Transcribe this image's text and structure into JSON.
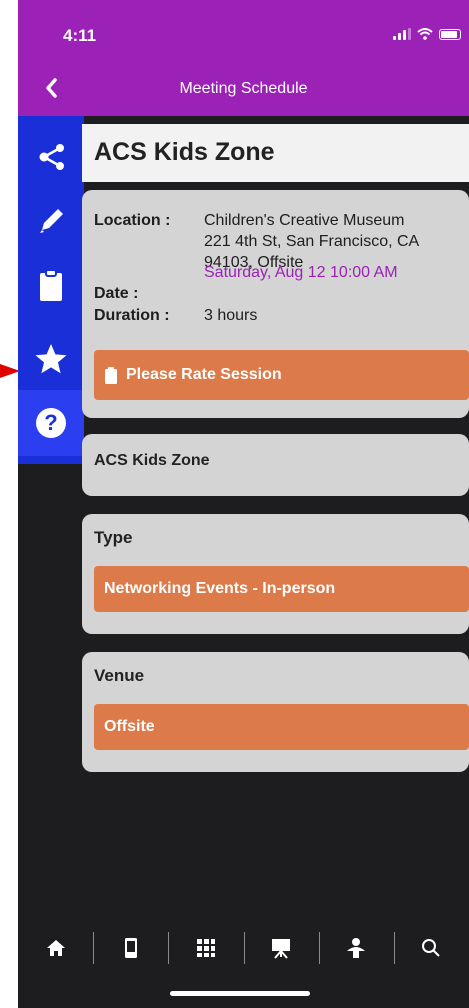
{
  "status_bar": {
    "time": "4:11"
  },
  "nav": {
    "title": "Meeting Schedule",
    "back_icon": "chevron-left-icon"
  },
  "side_toolbar": {
    "items": [
      {
        "icon": "share-icon"
      },
      {
        "icon": "pencil-icon"
      },
      {
        "icon": "clipboard-icon"
      },
      {
        "icon": "star-icon"
      },
      {
        "icon": "help-icon",
        "glyph": "?"
      }
    ]
  },
  "session": {
    "title": "ACS Kids Zone",
    "location_label": "Location :",
    "location_lines": [
      "Children's Creative Museum",
      "221 4th St, San Francisco, CA",
      "94103, Offsite"
    ],
    "date_label": "Date :",
    "date_value": "Saturday, Aug 12 10:00 AM",
    "duration_label": "Duration :",
    "duration_value": "3 hours",
    "rate_button": "Please Rate Session",
    "description": "ACS Kids Zone"
  },
  "type_section": {
    "label": "Type",
    "value": "Networking Events - In-person"
  },
  "venue_section": {
    "label": "Venue",
    "value": "Offsite"
  },
  "tab_bar": {
    "tabs": [
      {
        "icon": "home-icon"
      },
      {
        "icon": "phone-icon"
      },
      {
        "icon": "grid-icon"
      },
      {
        "icon": "presentation-icon"
      },
      {
        "icon": "person-icon"
      },
      {
        "icon": "search-icon"
      }
    ]
  },
  "colors": {
    "header": "#9c21b6",
    "toolbar": "#1a2fd8",
    "accent_button": "#dd7a4a",
    "card": "#d4d4d4",
    "background": "#1d1d1f",
    "date_text": "#9c21b6",
    "pointer_arrow": "#e00000"
  }
}
